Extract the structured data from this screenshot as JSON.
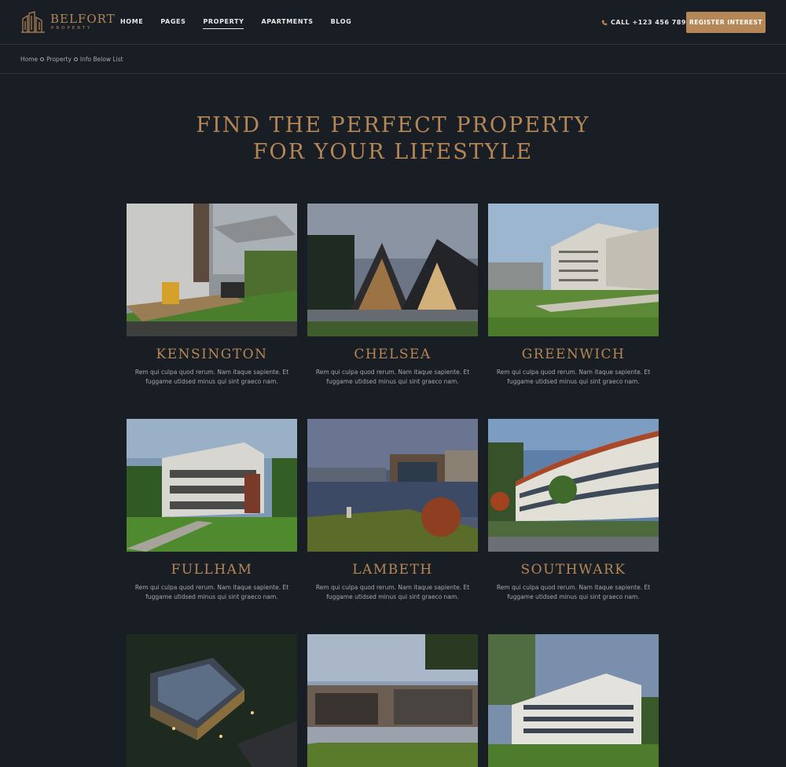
{
  "brand": {
    "name": "BELFORT",
    "sub": "PROPERTY",
    "color": "#b58757"
  },
  "nav": [
    {
      "label": "HOME"
    },
    {
      "label": "PAGES"
    },
    {
      "label": "PROPERTY",
      "active": true
    },
    {
      "label": "APARTMENTS"
    },
    {
      "label": "BLOG"
    }
  ],
  "header": {
    "call": "CALL +123 456 789",
    "cta": "REGISTER INTEREST"
  },
  "breadcrumb": [
    "Home",
    "Property",
    "Info Below List"
  ],
  "title": {
    "line1": "FIND THE PERFECT PROPERTY",
    "line2": "FOR YOUR LIFESTYLE"
  },
  "properties": [
    {
      "name": "KENSINGTON",
      "line1": "Rem qui culpa quod rerum. Nam itaque sapiente. Et",
      "line2": "fuggame utidsed minus qui sint graeco nam."
    },
    {
      "name": "CHELSEA",
      "line1": "Rem qui culpa quod rerum. Nam itaque sapiente. Et",
      "line2": "fuggame utidsed minus qui sint graeco nam."
    },
    {
      "name": "GREENWICH",
      "line1": "Rem qui culpa quod rerum. Nam itaque sapiente. Et",
      "line2": "fuggame utidsed minus qui sint graeco nam."
    },
    {
      "name": "FULLHAM",
      "line1": "Rem qui culpa quod rerum. Nam itaque sapiente. Et",
      "line2": "fuggame utidsed minus qui sint graeco nam."
    },
    {
      "name": "LAMBETH",
      "line1": "Rem qui culpa quod rerum. Nam itaque sapiente. Et",
      "line2": "fuggame utidsed minus qui sint graeco nam."
    },
    {
      "name": "SOUTHWARK",
      "line1": "Rem qui culpa quod rerum. Nam itaque sapiente. Et",
      "line2": "fuggame utidsed minus qui sint graeco nam."
    }
  ]
}
